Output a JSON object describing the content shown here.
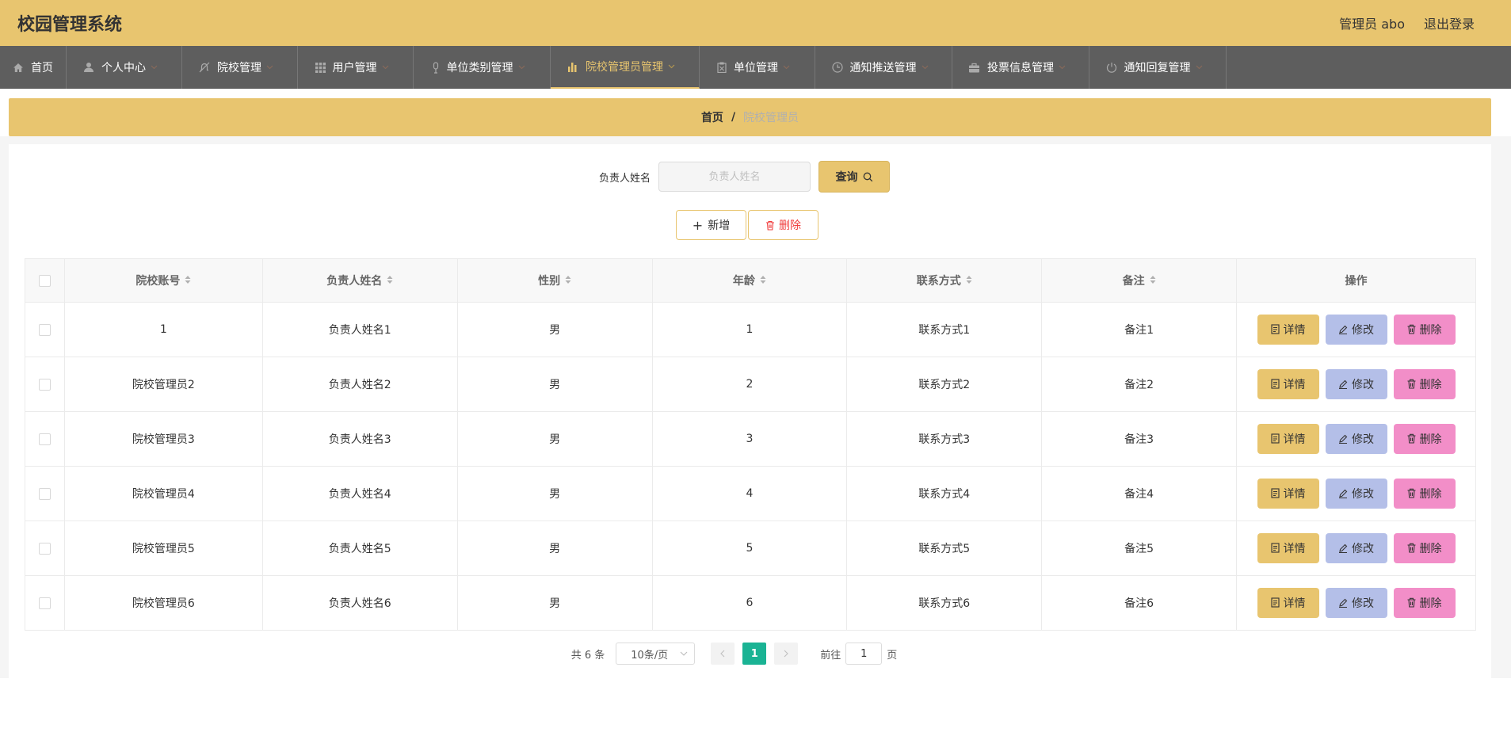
{
  "header": {
    "title": "校园管理系统",
    "user": "管理员 abo",
    "logout": "退出登录"
  },
  "nav": [
    {
      "label": "首页",
      "icon": "home-icon",
      "w": 84
    },
    {
      "label": "个人中心",
      "icon": "user-icon",
      "w": 146
    },
    {
      "label": "院校管理",
      "icon": "bell-off-icon",
      "w": 146
    },
    {
      "label": "用户管理",
      "icon": "grid-icon",
      "w": 146
    },
    {
      "label": "单位类别管理",
      "icon": "microphone-icon",
      "w": 173
    },
    {
      "label": "院校管理员管理",
      "icon": "bar-chart-icon",
      "w": 188
    },
    {
      "label": "单位管理",
      "icon": "clipboard-icon",
      "w": 146
    },
    {
      "label": "通知推送管理",
      "icon": "clock-icon",
      "w": 173
    },
    {
      "label": "投票信息管理",
      "icon": "briefcase-icon",
      "w": 173
    },
    {
      "label": "通知回复管理",
      "icon": "power-icon",
      "w": 173
    }
  ],
  "breadcrumb": {
    "home": "首页",
    "sep": "/",
    "current": "院校管理员"
  },
  "search": {
    "label": "负责人姓名",
    "placeholder": "负责人姓名",
    "button": "查询"
  },
  "actions": {
    "add": "新增",
    "delete": "删除"
  },
  "table": {
    "columns": [
      "院校账号",
      "负责人姓名",
      "性别",
      "年龄",
      "联系方式",
      "备注",
      "操作"
    ],
    "rows": [
      [
        "1",
        "负责人姓名1",
        "男",
        "1",
        "联系方式1",
        "备注1"
      ],
      [
        "院校管理员2",
        "负责人姓名2",
        "男",
        "2",
        "联系方式2",
        "备注2"
      ],
      [
        "院校管理员3",
        "负责人姓名3",
        "男",
        "3",
        "联系方式3",
        "备注3"
      ],
      [
        "院校管理员4",
        "负责人姓名4",
        "男",
        "4",
        "联系方式4",
        "备注4"
      ],
      [
        "院校管理员5",
        "负责人姓名5",
        "男",
        "5",
        "联系方式5",
        "备注5"
      ],
      [
        "院校管理员6",
        "负责人姓名6",
        "男",
        "6",
        "联系方式6",
        "备注6"
      ]
    ],
    "row_actions": {
      "detail": "详情",
      "edit": "修改",
      "delete": "删除"
    }
  },
  "pagination": {
    "total": "共 6 条",
    "page_size": "10条/页",
    "current": "1",
    "goto_prefix": "前往",
    "goto_value": "1",
    "goto_suffix": "页"
  },
  "colors": {
    "accent": "#e8c56f",
    "nav_bg": "#5e5e5e",
    "edit": "#b4bfe8",
    "delete": "#f28ec8",
    "pager_active": "#1ab394"
  }
}
